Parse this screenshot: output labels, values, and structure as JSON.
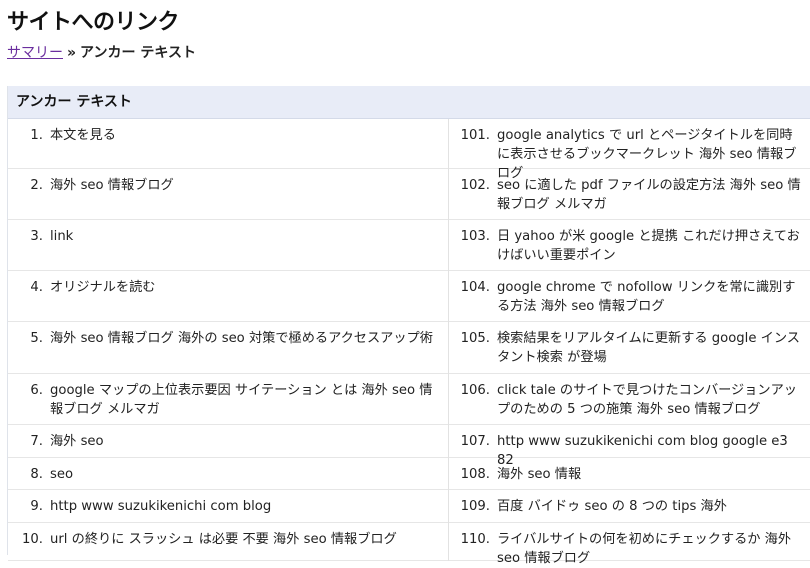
{
  "page": {
    "title": "サイトへのリンク",
    "breadcrumb": {
      "summary": "サマリー",
      "separator": "»",
      "current": "アンカー テキスト"
    },
    "section_header": "アンカー テキスト"
  },
  "left_items": [
    {
      "num": "1.",
      "text": "本文を見る"
    },
    {
      "num": "2.",
      "text": "海外 seo 情報ブログ"
    },
    {
      "num": "3.",
      "text": "link"
    },
    {
      "num": "4.",
      "text": "オリジナルを読む"
    },
    {
      "num": "5.",
      "text": "海外 seo 情報ブログ 海外の seo 対策で極めるアクセスアップ術"
    },
    {
      "num": "6.",
      "text": "google マップの上位表示要因 サイテーション とは 海外 seo 情報ブログ メルマガ"
    },
    {
      "num": "7.",
      "text": "海外 seo"
    },
    {
      "num": "8.",
      "text": "seo"
    },
    {
      "num": "9.",
      "text": "http www suzukikenichi com blog"
    },
    {
      "num": "10.",
      "text": "url の終りに スラッシュ は必要 不要 海外 seo 情報ブログ"
    }
  ],
  "right_items": [
    {
      "num": "101.",
      "text": "google analytics で url とページタイトルを同時に表示させるブックマークレット 海外 seo 情報ブログ"
    },
    {
      "num": "102.",
      "text": "seo に適した pdf ファイルの設定方法 海外 seo 情報ブログ メルマガ"
    },
    {
      "num": "103.",
      "text": "日 yahoo が米 google と提携 これだけ押さえておけばいい重要ポイン"
    },
    {
      "num": "104.",
      "text": "google chrome で nofollow リンクを常に識別する方法 海外 seo 情報ブログ"
    },
    {
      "num": "105.",
      "text": "検索結果をリアルタイムに更新する google インスタント検索 が登場"
    },
    {
      "num": "106.",
      "text": "click tale のサイトで見つけたコンバージョンアップのための 5 つの施策 海外 seo 情報ブログ"
    },
    {
      "num": "107.",
      "text": "http www suzukikenichi com blog google e3 82"
    },
    {
      "num": "108.",
      "text": "海外 seo 情報"
    },
    {
      "num": "109.",
      "text": "百度 バイドゥ seo の 8 つの tips 海外"
    },
    {
      "num": "110.",
      "text": "ライバルサイトの何を初めにチェックするか 海外 seo 情報ブログ"
    }
  ]
}
